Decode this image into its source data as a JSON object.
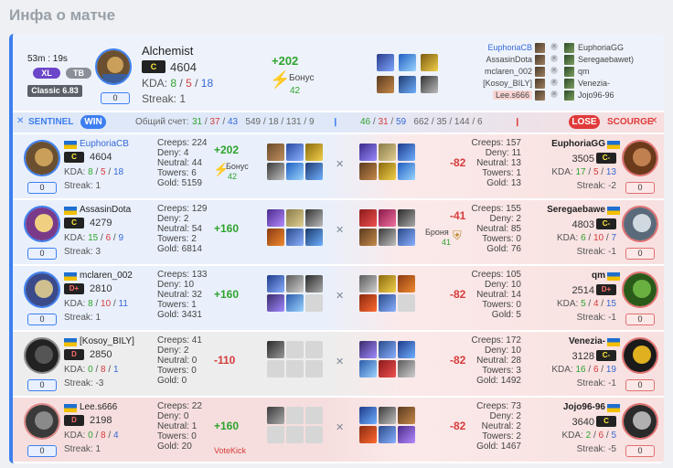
{
  "page_title": "Инфа о матче",
  "summary": {
    "duration": "53m : 19s",
    "tags": [
      "XL",
      "TB"
    ],
    "version": "Classic 6.83",
    "hero_level": "0",
    "hero": "Alchemist",
    "rank": "C",
    "rating": "4604",
    "kda_label": "KDA:",
    "kda": [
      "8",
      "5",
      "18"
    ],
    "streak": "Streak: 1",
    "delta": "+202",
    "bonus_label": "Бонус",
    "bonus": "42",
    "team_left": [
      "EuphoriaCB",
      "AssasinDota",
      "mclaren_002",
      "[Kosoy_BILY]",
      "Lee.s666"
    ],
    "team_right": [
      "EuphoriaGG",
      "Seregaebawet)",
      "qm",
      "Venezia-",
      "Jojo96-96"
    ]
  },
  "teams": {
    "sentinel": "SENTINEL",
    "win": "WIN",
    "score_label": "Общий счет:",
    "left_kills": "31",
    "left_deaths": "37",
    "left_assists": "43",
    "left_totals": [
      "549",
      "18",
      "131",
      "9"
    ],
    "right_kills": "46",
    "right_deaths": "31",
    "right_assists": "59",
    "right_totals": [
      "662",
      "35",
      "144",
      "6"
    ],
    "lose": "LOSE",
    "scourge": "SCOURGE"
  },
  "players": [
    {
      "name": "EuphoriaCB",
      "rank": "C",
      "rating": "4604",
      "kda": [
        "8",
        "5",
        "18"
      ],
      "streak": "Streak: 1",
      "level": "0",
      "creeps": "Creeps: 224",
      "deny": "Deny: 4",
      "neutral": "Neutral: 44",
      "towers": "Towers: 6",
      "gold": "Gold: 5159",
      "delta": "+202",
      "bonus_label": "Бонус",
      "bonus": "42",
      "opp_name": "EuphoriaGG",
      "opp_rank": "C-",
      "opp_rating": "3505",
      "opp_kda": [
        "17",
        "5",
        "13"
      ],
      "opp_streak": "Streak: -2",
      "opp_level": "0",
      "opp_creeps": "Creeps: 157",
      "opp_deny": "Deny: 11",
      "opp_neutral": "Neutral: 13",
      "opp_towers": "Towers: 1",
      "opp_gold": "Gold: 13",
      "opp_delta": "-82"
    },
    {
      "name": "AssasinDota",
      "rank": "C",
      "rating": "4279",
      "kda": [
        "15",
        "6",
        "9"
      ],
      "streak": "Streak: 3",
      "level": "0",
      "creeps": "Creeps: 129",
      "deny": "Deny: 2",
      "neutral": "Neutral: 54",
      "towers": "Towers: 2",
      "gold": "Gold: 6814",
      "delta": "+160",
      "opp_name": "Seregaebawe",
      "opp_rank": "C-",
      "opp_rating": "4803",
      "opp_kda": [
        "6",
        "10",
        "7"
      ],
      "opp_streak": "Streak: -1",
      "opp_level": "0",
      "opp_creeps": "Creeps: 155",
      "opp_deny": "Deny: 2",
      "opp_neutral": "Neutral: 85",
      "opp_towers": "Towers: 0",
      "opp_gold": "Gold: 76",
      "opp_delta": "-41",
      "opp_bonus_label": "Броня",
      "opp_bonus": "41"
    },
    {
      "name": "mclaren_002",
      "rank": "D+",
      "rating": "2810",
      "kda": [
        "8",
        "10",
        "11"
      ],
      "streak": "Streak: 1",
      "level": "0",
      "creeps": "Creeps: 133",
      "deny": "Deny: 10",
      "neutral": "Neutral: 32",
      "towers": "Towers: 1",
      "gold": "Gold: 3431",
      "delta": "+160",
      "opp_name": "qm",
      "opp_rank": "D+",
      "opp_rating": "2514",
      "opp_kda": [
        "5",
        "4",
        "15"
      ],
      "opp_streak": "Streak: -1",
      "opp_level": "0",
      "opp_creeps": "Creeps: 105",
      "opp_deny": "Deny: 10",
      "opp_neutral": "Neutral: 14",
      "opp_towers": "Towers: 0",
      "opp_gold": "Gold: 5",
      "opp_delta": "-82"
    },
    {
      "name": "[Kosoy_BILY]",
      "rank": "D",
      "rating": "2850",
      "kda": [
        "0",
        "8",
        "1"
      ],
      "streak": "Streak: -3",
      "level": "0",
      "creeps": "Creeps: 41",
      "deny": "Deny: 2",
      "neutral": "Neutral: 0",
      "towers": "Towers: 0",
      "gold": "Gold: 0",
      "delta": "-110",
      "opp_name": "Venezia-",
      "opp_rank": "C-",
      "opp_rating": "3128",
      "opp_kda": [
        "16",
        "6",
        "19"
      ],
      "opp_streak": "Streak: -1",
      "opp_level": "0",
      "opp_creeps": "Creeps: 172",
      "opp_deny": "Deny: 10",
      "opp_neutral": "Neutral: 28",
      "opp_towers": "Towers: 3",
      "opp_gold": "Gold: 1492",
      "opp_delta": "-82"
    },
    {
      "name": "Lee.s666",
      "rank": "D",
      "rating": "2198",
      "kda": [
        "0",
        "8",
        "4"
      ],
      "streak": "Streak: 1",
      "level": "0",
      "creeps": "Creeps: 22",
      "deny": "Deny: 0",
      "neutral": "Neutral: 1",
      "towers": "Towers: 0",
      "gold": "Gold: 20",
      "delta": "+160",
      "votekick": "VoteKick",
      "opp_name": "Jojo96-96",
      "opp_rank": "C",
      "opp_rating": "3640",
      "opp_kda": [
        "2",
        "6",
        "5"
      ],
      "opp_streak": "Streak: -5",
      "opp_level": "0",
      "opp_creeps": "Creeps: 73",
      "opp_deny": "Deny: 2",
      "opp_neutral": "Neutral: 2",
      "opp_towers": "Towers: 2",
      "opp_gold": "Gold: 1467",
      "opp_delta": "-82"
    }
  ],
  "colors": {
    "accent": "#3d7ff0",
    "win": "#2ea32e",
    "lose": "#e03a3a",
    "row_lose": "#f6e2e2",
    "row_neutral": "#ededed",
    "row_sentinel": "#e9f0fb"
  },
  "icons": [
    "swords-icon",
    "lightning-icon",
    "armor-icon",
    "close-icon"
  ]
}
